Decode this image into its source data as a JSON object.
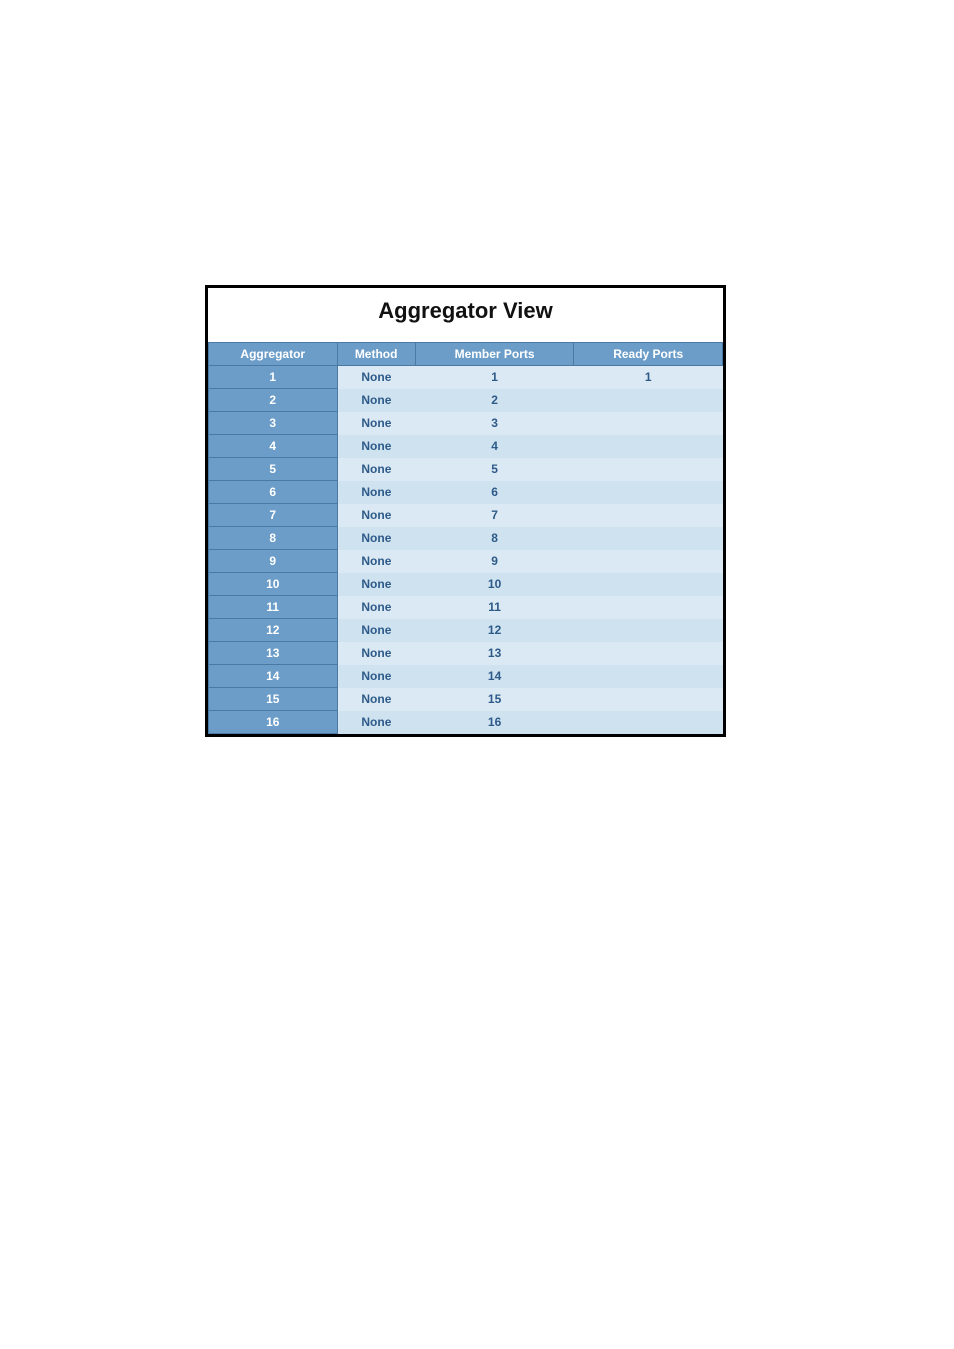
{
  "title": "Aggregator View",
  "columns": {
    "aggregator": "Aggregator",
    "method": "Method",
    "member_ports": "Member Ports",
    "ready_ports": "Ready Ports"
  },
  "rows": [
    {
      "aggregator": "1",
      "method": "None",
      "member_ports": "1",
      "ready_ports": "1"
    },
    {
      "aggregator": "2",
      "method": "None",
      "member_ports": "2",
      "ready_ports": ""
    },
    {
      "aggregator": "3",
      "method": "None",
      "member_ports": "3",
      "ready_ports": ""
    },
    {
      "aggregator": "4",
      "method": "None",
      "member_ports": "4",
      "ready_ports": ""
    },
    {
      "aggregator": "5",
      "method": "None",
      "member_ports": "5",
      "ready_ports": ""
    },
    {
      "aggregator": "6",
      "method": "None",
      "member_ports": "6",
      "ready_ports": ""
    },
    {
      "aggregator": "7",
      "method": "None",
      "member_ports": "7",
      "ready_ports": ""
    },
    {
      "aggregator": "8",
      "method": "None",
      "member_ports": "8",
      "ready_ports": ""
    },
    {
      "aggregator": "9",
      "method": "None",
      "member_ports": "9",
      "ready_ports": ""
    },
    {
      "aggregator": "10",
      "method": "None",
      "member_ports": "10",
      "ready_ports": ""
    },
    {
      "aggregator": "11",
      "method": "None",
      "member_ports": "11",
      "ready_ports": ""
    },
    {
      "aggregator": "12",
      "method": "None",
      "member_ports": "12",
      "ready_ports": ""
    },
    {
      "aggregator": "13",
      "method": "None",
      "member_ports": "13",
      "ready_ports": ""
    },
    {
      "aggregator": "14",
      "method": "None",
      "member_ports": "14",
      "ready_ports": ""
    },
    {
      "aggregator": "15",
      "method": "None",
      "member_ports": "15",
      "ready_ports": ""
    },
    {
      "aggregator": "16",
      "method": "None",
      "member_ports": "16",
      "ready_ports": ""
    }
  ]
}
